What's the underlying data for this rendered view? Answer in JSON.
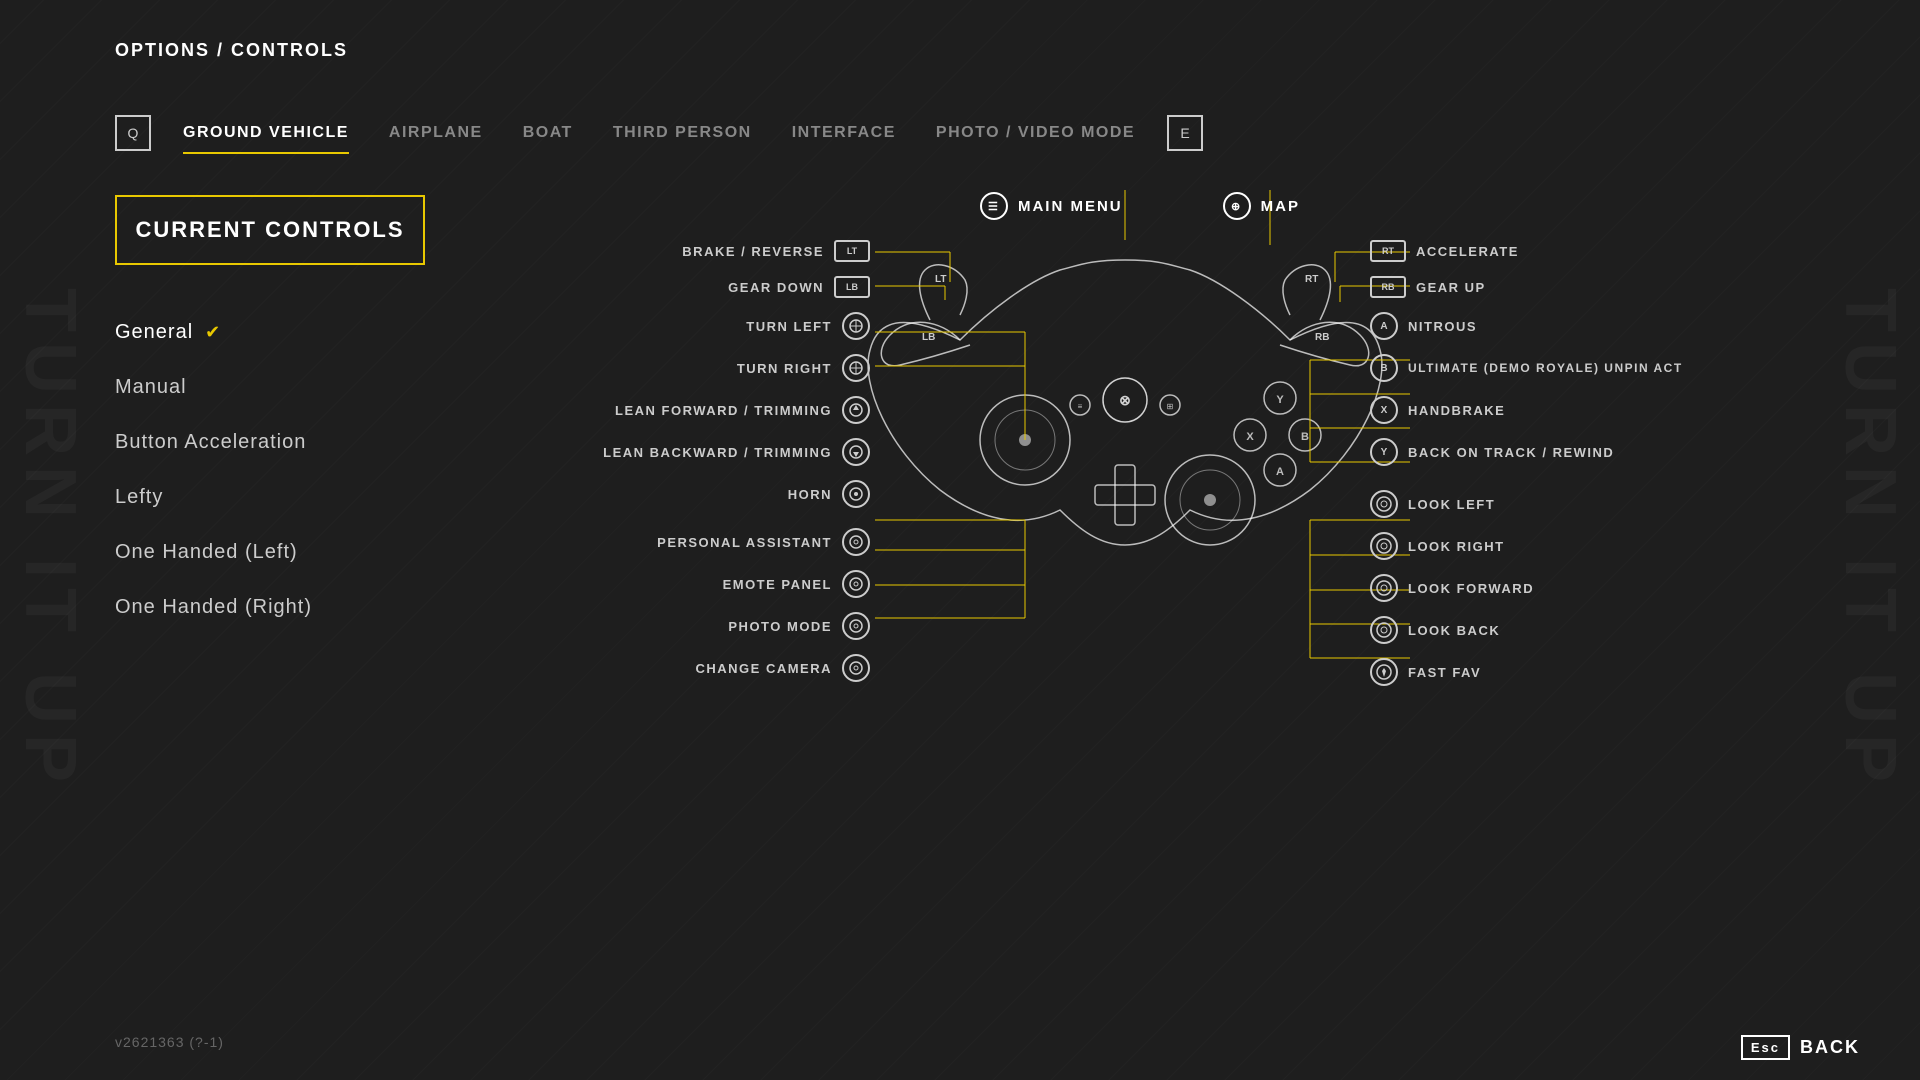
{
  "breadcrumb": {
    "prefix": "OPTIONS / ",
    "current": "CONTROLS"
  },
  "tabs": {
    "left_bracket": "Q",
    "right_bracket": "E",
    "items": [
      {
        "label": "GROUND VEHICLE",
        "active": true
      },
      {
        "label": "AIRPLANE",
        "active": false
      },
      {
        "label": "BOAT",
        "active": false
      },
      {
        "label": "THIRD PERSON",
        "active": false
      },
      {
        "label": "INTERFACE",
        "active": false
      },
      {
        "label": "PHOTO / VIDEO MODE",
        "active": false
      }
    ]
  },
  "current_controls_btn": "CURRENT CONTROLS",
  "presets": [
    {
      "label": "General",
      "active": true
    },
    {
      "label": "Manual",
      "active": false
    },
    {
      "label": "Button Acceleration",
      "active": false
    },
    {
      "label": "Lefty",
      "active": false
    },
    {
      "label": "One Handed (Left)",
      "active": false
    },
    {
      "label": "One Handed (Right)",
      "active": false
    }
  ],
  "top_labels": [
    {
      "icon": "☰",
      "text": "MAIN MENU"
    },
    {
      "icon": "⊕",
      "text": "MAP"
    }
  ],
  "left_controls": [
    {
      "label": "BRAKE / REVERSE",
      "icon": "LT",
      "type": "rect"
    },
    {
      "label": "GEAR DOWN",
      "icon": "LB",
      "type": "rect"
    },
    {
      "label": "TURN LEFT",
      "icon": "L",
      "type": "circle"
    },
    {
      "label": "TURN RIGHT",
      "icon": "L",
      "type": "circle"
    },
    {
      "label": "LEAN FORWARD / TRIMMING",
      "icon": "L",
      "type": "circle"
    },
    {
      "label": "LEAN BACKWARD / TRIMMING",
      "icon": "L",
      "type": "circle"
    },
    {
      "label": "HORN",
      "icon": "L",
      "type": "circle"
    },
    {
      "label": "PERSONAL ASSISTANT",
      "icon": "⊙",
      "type": "circle"
    },
    {
      "label": "EMOTE PANEL",
      "icon": "⊙",
      "type": "circle"
    },
    {
      "label": "PHOTO MODE",
      "icon": "⊙",
      "type": "circle"
    },
    {
      "label": "CHANGE CAMERA",
      "icon": "⊙",
      "type": "circle"
    }
  ],
  "right_controls": [
    {
      "icon": "RT",
      "label": "ACCELERATE",
      "type": "rect"
    },
    {
      "icon": "RB",
      "label": "GEAR UP",
      "type": "rect"
    },
    {
      "icon": "A",
      "label": "NITROUS",
      "type": "circle"
    },
    {
      "icon": "B",
      "label": "ULTIMATE (DEMO ROYALE)   UNPIN ACT",
      "type": "circle"
    },
    {
      "icon": "X",
      "label": "HANDBRAKE",
      "type": "circle"
    },
    {
      "icon": "Y",
      "label": "BACK ON TRACK / REWIND",
      "type": "circle"
    },
    {
      "icon": "R",
      "label": "LOOK LEFT",
      "type": "circle"
    },
    {
      "icon": "R",
      "label": "LOOK RIGHT",
      "type": "circle"
    },
    {
      "icon": "R",
      "label": "LOOK FORWARD",
      "type": "circle"
    },
    {
      "icon": "R",
      "label": "LOOK BACK",
      "type": "circle"
    },
    {
      "icon": "R",
      "label": "FAST FAV",
      "type": "circle"
    }
  ],
  "version": "v2621363 (?-1)",
  "back_btn": {
    "key": "Esc",
    "label": "BACK"
  }
}
